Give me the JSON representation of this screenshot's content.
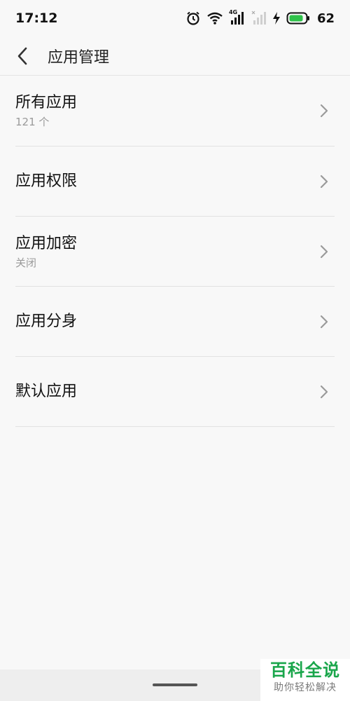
{
  "status_bar": {
    "time": "17:12",
    "network_label": "4G",
    "battery": "62",
    "icons": [
      "alarm-icon",
      "wifi-icon",
      "signal-4g-icon",
      "signal-no-sim-icon",
      "charging-icon",
      "battery-icon"
    ],
    "battery_color": "#2fc24a"
  },
  "header": {
    "title": "应用管理",
    "back_icon": "chevron-left-icon"
  },
  "items": [
    {
      "title": "所有应用",
      "subtitle": "121 个"
    },
    {
      "title": "应用权限",
      "subtitle": ""
    },
    {
      "title": "应用加密",
      "subtitle": "关闭"
    },
    {
      "title": "应用分身",
      "subtitle": ""
    },
    {
      "title": "默认应用",
      "subtitle": ""
    }
  ],
  "watermark": {
    "main": "百科全说",
    "sub": "助你轻松解决",
    "color": "#1aa64b"
  }
}
